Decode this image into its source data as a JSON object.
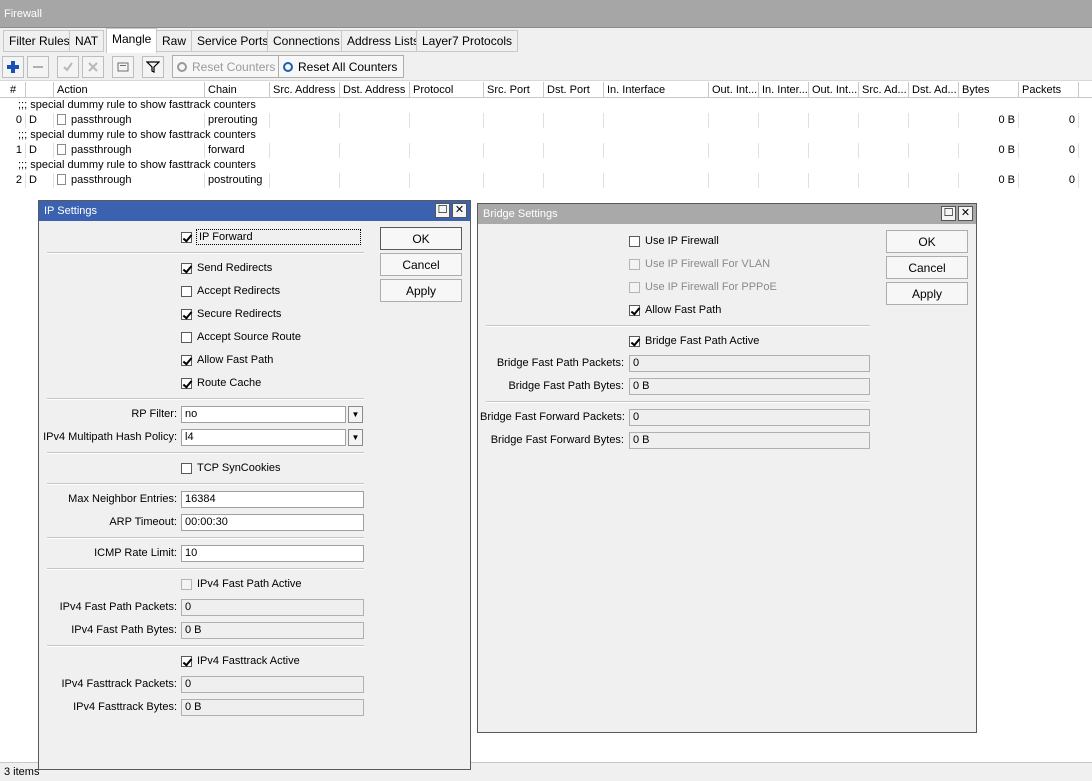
{
  "window_title": "Firewall",
  "tabs": [
    "Filter Rules",
    "NAT",
    "Mangle",
    "Raw",
    "Service Ports",
    "Connections",
    "Address Lists",
    "Layer7 Protocols"
  ],
  "toolbar": {
    "reset_counters": "Reset Counters",
    "reset_all_counters": "Reset All Counters"
  },
  "columns": [
    "#",
    "Action",
    "Chain",
    "Src. Address",
    "Dst. Address",
    "Protocol",
    "Src. Port",
    "Dst. Port",
    "In. Interface",
    "Out. Int...",
    "In. Inter...",
    "Out. Int...",
    "Src. Ad...",
    "Dst. Ad...",
    "Bytes",
    "Packets"
  ],
  "rules": [
    {
      "comment": ";;; special dummy rule to show fasttrack counters",
      "num": "0",
      "flag": "D",
      "action": "passthrough",
      "chain": "prerouting",
      "bytes": "0 B",
      "packets": "0"
    },
    {
      "comment": ";;; special dummy rule to show fasttrack counters",
      "num": "1",
      "flag": "D",
      "action": "passthrough",
      "chain": "forward",
      "bytes": "0 B",
      "packets": "0"
    },
    {
      "comment": ";;; special dummy rule to show fasttrack counters",
      "num": "2",
      "flag": "D",
      "action": "passthrough",
      "chain": "postrouting",
      "bytes": "0 B",
      "packets": "0"
    }
  ],
  "status": "3 items",
  "ip_settings": {
    "title": "IP Settings",
    "buttons": {
      "ok": "OK",
      "cancel": "Cancel",
      "apply": "Apply"
    },
    "ip_forward": "IP Forward",
    "send_redirects": "Send Redirects",
    "accept_redirects": "Accept Redirects",
    "secure_redirects": "Secure Redirects",
    "accept_source_route": "Accept Source Route",
    "allow_fast_path": "Allow Fast Path",
    "route_cache": "Route Cache",
    "rp_filter_label": "RP Filter:",
    "rp_filter_value": "no",
    "multipath_label": "IPv4 Multipath Hash Policy:",
    "multipath_value": "l4",
    "tcp_syncookies": "TCP SynCookies",
    "max_neighbor_label": "Max Neighbor Entries:",
    "max_neighbor_value": "16384",
    "arp_timeout_label": "ARP Timeout:",
    "arp_timeout_value": "00:00:30",
    "icmp_rate_label": "ICMP Rate Limit:",
    "icmp_rate_value": "10",
    "fastpath_active": "IPv4 Fast Path Active",
    "fastpath_packets_label": "IPv4 Fast Path Packets:",
    "fastpath_packets_value": "0",
    "fastpath_bytes_label": "IPv4 Fast Path Bytes:",
    "fastpath_bytes_value": "0 B",
    "fasttrack_active": "IPv4 Fasttrack Active",
    "fasttrack_packets_label": "IPv4 Fasttrack Packets:",
    "fasttrack_packets_value": "0",
    "fasttrack_bytes_label": "IPv4 Fasttrack Bytes:",
    "fasttrack_bytes_value": "0 B"
  },
  "bridge_settings": {
    "title": "Bridge Settings",
    "buttons": {
      "ok": "OK",
      "cancel": "Cancel",
      "apply": "Apply"
    },
    "use_ip_firewall": "Use IP Firewall",
    "use_ip_firewall_vlan": "Use IP Firewall For VLAN",
    "use_ip_firewall_pppoe": "Use IP Firewall For PPPoE",
    "allow_fast_path": "Allow Fast Path",
    "fast_path_active": "Bridge Fast Path Active",
    "fast_path_packets_label": "Bridge Fast Path Packets:",
    "fast_path_packets_value": "0",
    "fast_path_bytes_label": "Bridge Fast Path Bytes:",
    "fast_path_bytes_value": "0 B",
    "fast_forward_packets_label": "Bridge Fast Forward Packets:",
    "fast_forward_packets_value": "0",
    "fast_forward_bytes_label": "Bridge Fast Forward Bytes:",
    "fast_forward_bytes_value": "0 B"
  }
}
